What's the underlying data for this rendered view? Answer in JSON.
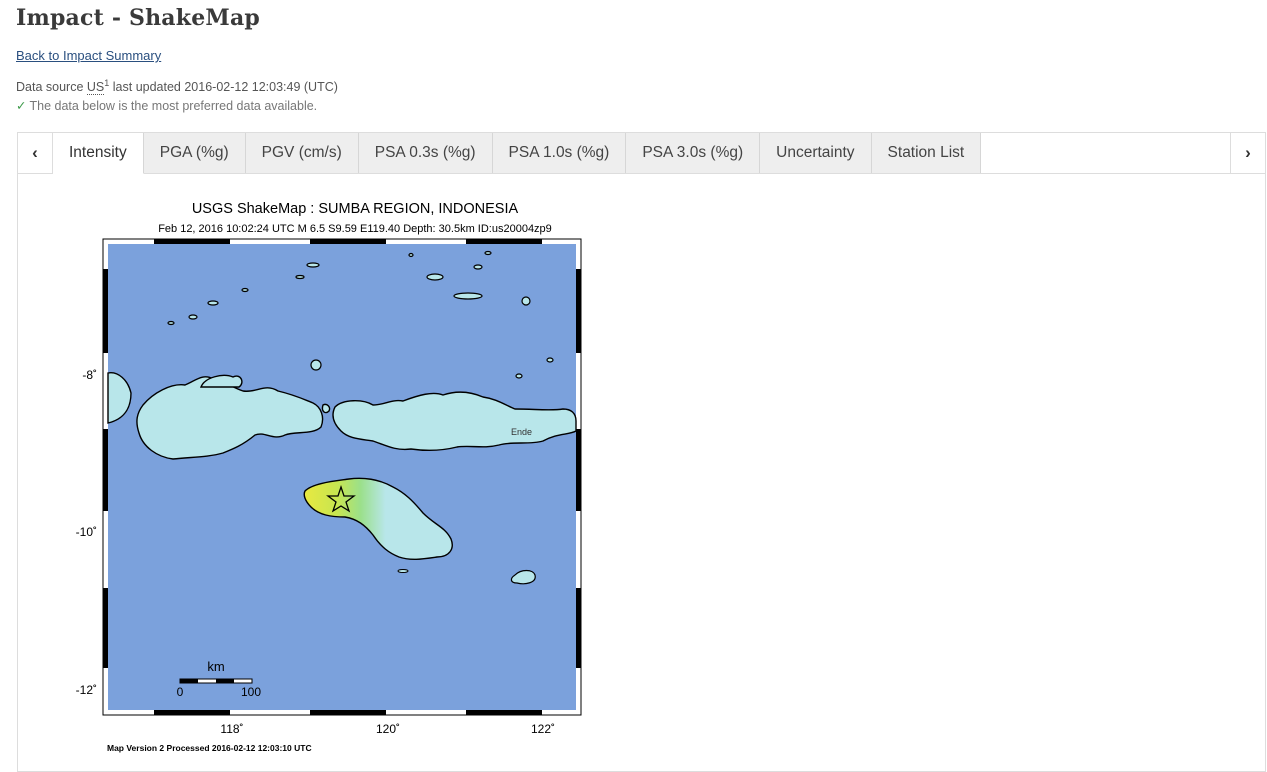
{
  "page": {
    "title": "Impact - ShakeMap",
    "back_link": "Back to Impact Summary",
    "data_source_label": "Data source",
    "data_source_code": "US",
    "data_source_sup": "1",
    "last_updated": "last updated 2016-02-12 12:03:49 (UTC)",
    "preferred_note": "The data below is the most preferred data available."
  },
  "tabs": [
    {
      "label": "Intensity",
      "active": true
    },
    {
      "label": "PGA (%g)",
      "active": false
    },
    {
      "label": "PGV (cm/s)",
      "active": false
    },
    {
      "label": "PSA 0.3s (%g)",
      "active": false
    },
    {
      "label": "PSA 1.0s (%g)",
      "active": false
    },
    {
      "label": "PSA 3.0s (%g)",
      "active": false
    },
    {
      "label": "Uncertainty",
      "active": false
    },
    {
      "label": "Station List",
      "active": false
    }
  ],
  "nav": {
    "prev_icon": "chevron-left-icon",
    "next_icon": "chevron-right-icon"
  },
  "map": {
    "title": "USGS ShakeMap : SUMBA REGION, INDONESIA",
    "subtitle": "Feb 12, 2016 10:02:24 UTC   M 6.5   S9.59 E119.40   Depth: 30.5km   ID:us20004zp9",
    "lat_labels": [
      "-8˚",
      "-10˚",
      "-12˚"
    ],
    "lon_labels": [
      "118˚",
      "120˚",
      "122˚"
    ],
    "scale_unit": "km",
    "scale_min": "0",
    "scale_max": "100",
    "city_label": "Ende",
    "footer": "Map Version 2 Processed 2016-02-12 12:03:10 UTC",
    "ocean_color": "#7ba1dc",
    "land_color": "#b8e6ea",
    "epicenter_icon": "star-icon"
  }
}
